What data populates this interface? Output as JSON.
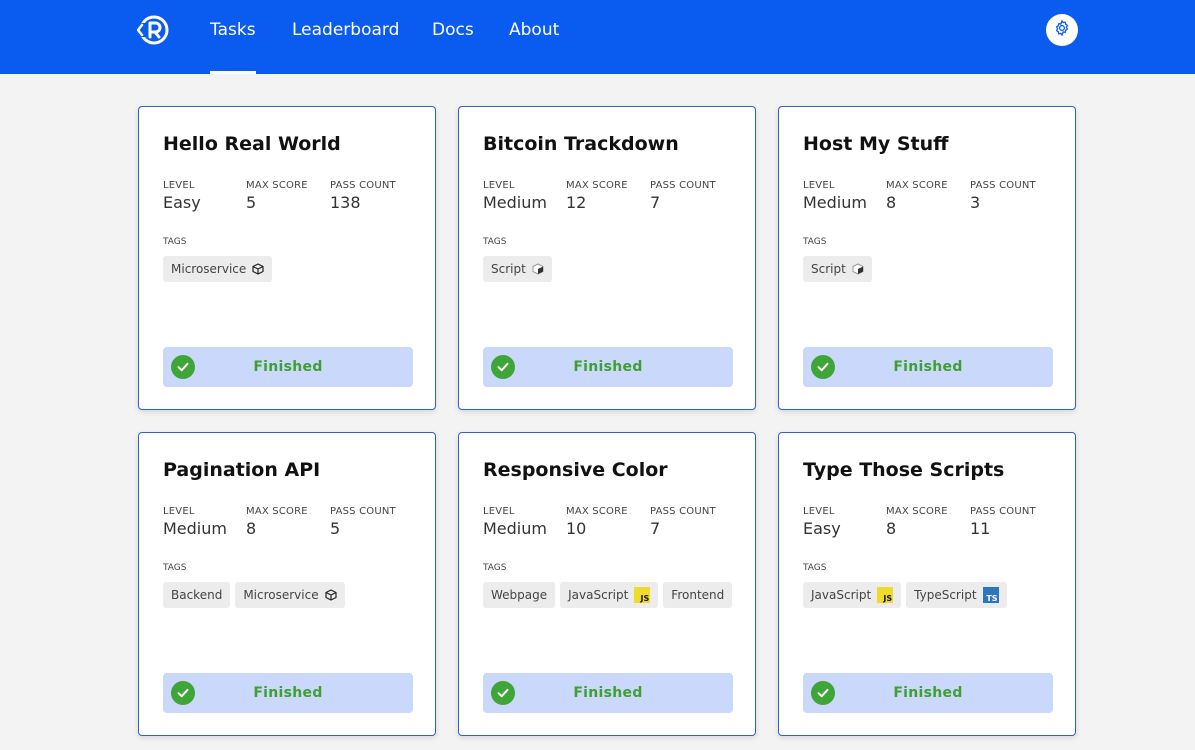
{
  "nav": {
    "items": [
      "Tasks",
      "Leaderboard",
      "Docs",
      "About"
    ],
    "active": "Tasks"
  },
  "labels": {
    "level": "LEVEL",
    "max_score": "MAX SCORE",
    "pass_count": "PASS COUNT",
    "tags": "TAGS"
  },
  "colors": {
    "brand": "#0a5cf0",
    "status_bg": "#c9d8fb",
    "status_text": "#3f9f2f",
    "card_border": "#2d62d6"
  },
  "cards": [
    {
      "title": "Hello Real World",
      "level": "Easy",
      "max_score": "5",
      "pass_count": "138",
      "tags": [
        {
          "label": "Microservice",
          "icon": "cube-icon"
        }
      ],
      "status": "Finished"
    },
    {
      "title": "Bitcoin Trackdown",
      "level": "Medium",
      "max_score": "12",
      "pass_count": "7",
      "tags": [
        {
          "label": "Script",
          "icon": "script-cube-icon"
        }
      ],
      "status": "Finished"
    },
    {
      "title": "Host My Stuff",
      "level": "Medium",
      "max_score": "8",
      "pass_count": "3",
      "tags": [
        {
          "label": "Script",
          "icon": "script-cube-icon"
        }
      ],
      "status": "Finished"
    },
    {
      "title": "Pagination API",
      "level": "Medium",
      "max_score": "8",
      "pass_count": "5",
      "tags": [
        {
          "label": "Backend",
          "icon": ""
        },
        {
          "label": "Microservice",
          "icon": "cube-icon"
        }
      ],
      "status": "Finished"
    },
    {
      "title": "Responsive Color",
      "level": "Medium",
      "max_score": "10",
      "pass_count": "7",
      "tags": [
        {
          "label": "Webpage",
          "icon": ""
        },
        {
          "label": "JavaScript",
          "icon": "js-icon"
        },
        {
          "label": "Frontend",
          "icon": ""
        }
      ],
      "status": "Finished"
    },
    {
      "title": "Type Those Scripts",
      "level": "Easy",
      "max_score": "8",
      "pass_count": "11",
      "tags": [
        {
          "label": "JavaScript",
          "icon": "js-icon"
        },
        {
          "label": "TypeScript",
          "icon": "ts-icon"
        }
      ],
      "status": "Finished"
    }
  ]
}
